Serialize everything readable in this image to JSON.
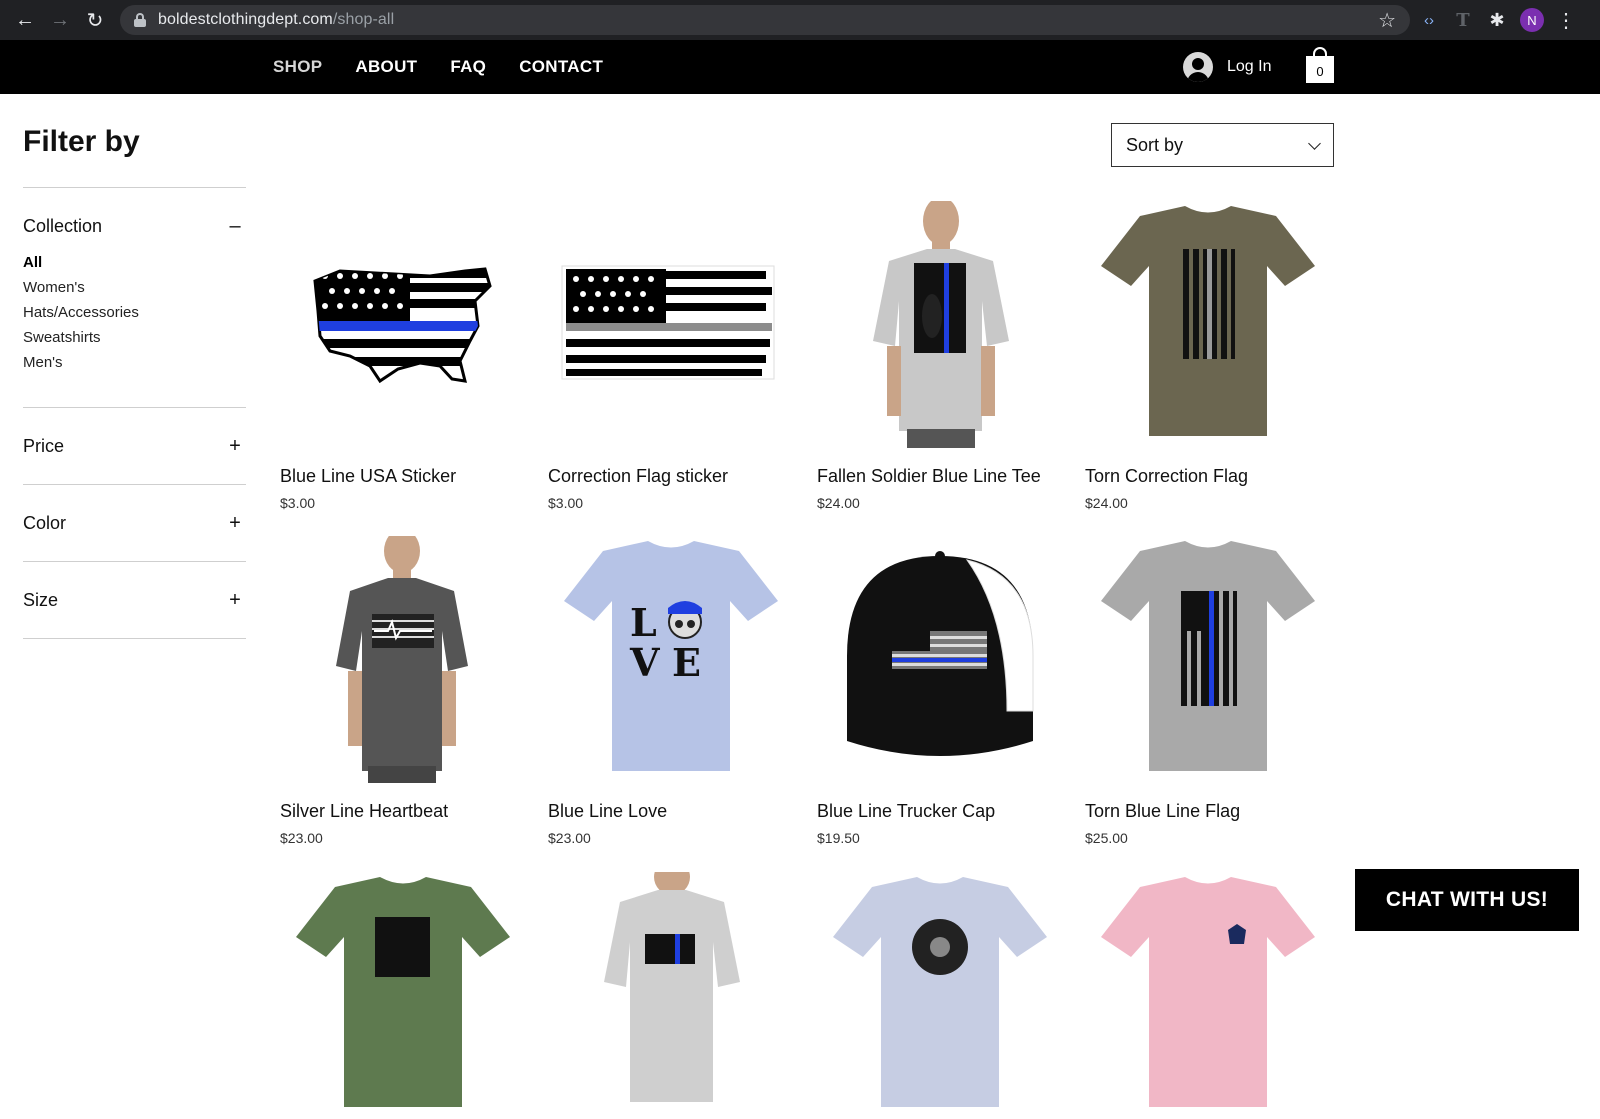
{
  "browser": {
    "url_host": "boldestclothingdept.com",
    "url_path": "/shop-all",
    "profile_initial": "N"
  },
  "nav": {
    "items": [
      "SHOP",
      "ABOUT",
      "FAQ",
      "CONTACT"
    ],
    "login": "Log In",
    "cart_count": "0"
  },
  "filter": {
    "title": "Filter by",
    "collection_label": "Collection",
    "collection_toggle": "–",
    "collections": [
      "All",
      "Women's",
      "Hats/Accessories",
      "Sweatshirts",
      "Men's"
    ],
    "price_label": "Price",
    "color_label": "Color",
    "size_label": "Size",
    "expand_toggle": "+"
  },
  "sort": {
    "label": "Sort by"
  },
  "products": [
    {
      "name": "Blue Line USA Sticker",
      "price": "$3.00",
      "icon": "usa-map-flag-sticker"
    },
    {
      "name": "Correction Flag sticker",
      "price": "$3.00",
      "icon": "flag-sticker"
    },
    {
      "name": "Fallen Soldier Blue Line Tee",
      "price": "$24.00",
      "icon": "model-gray-tee"
    },
    {
      "name": "Torn Correction Flag",
      "price": "$24.00",
      "icon": "olive-tee"
    },
    {
      "name": "Silver Line Heartbeat",
      "price": "$23.00",
      "icon": "model-charcoal-tee"
    },
    {
      "name": "Blue Line Love",
      "price": "$23.00",
      "icon": "light-blue-tee"
    },
    {
      "name": "Blue Line Trucker Cap",
      "price": "$19.50",
      "icon": "trucker-cap"
    },
    {
      "name": "Torn Blue Line Flag",
      "price": "$25.00",
      "icon": "gray-tee"
    }
  ],
  "chat": {
    "label": "CHAT WITH US!"
  },
  "colors": {
    "header_bg": "#000000",
    "accent_blue": "#1f3fe0",
    "chrome_bg": "#202124"
  }
}
